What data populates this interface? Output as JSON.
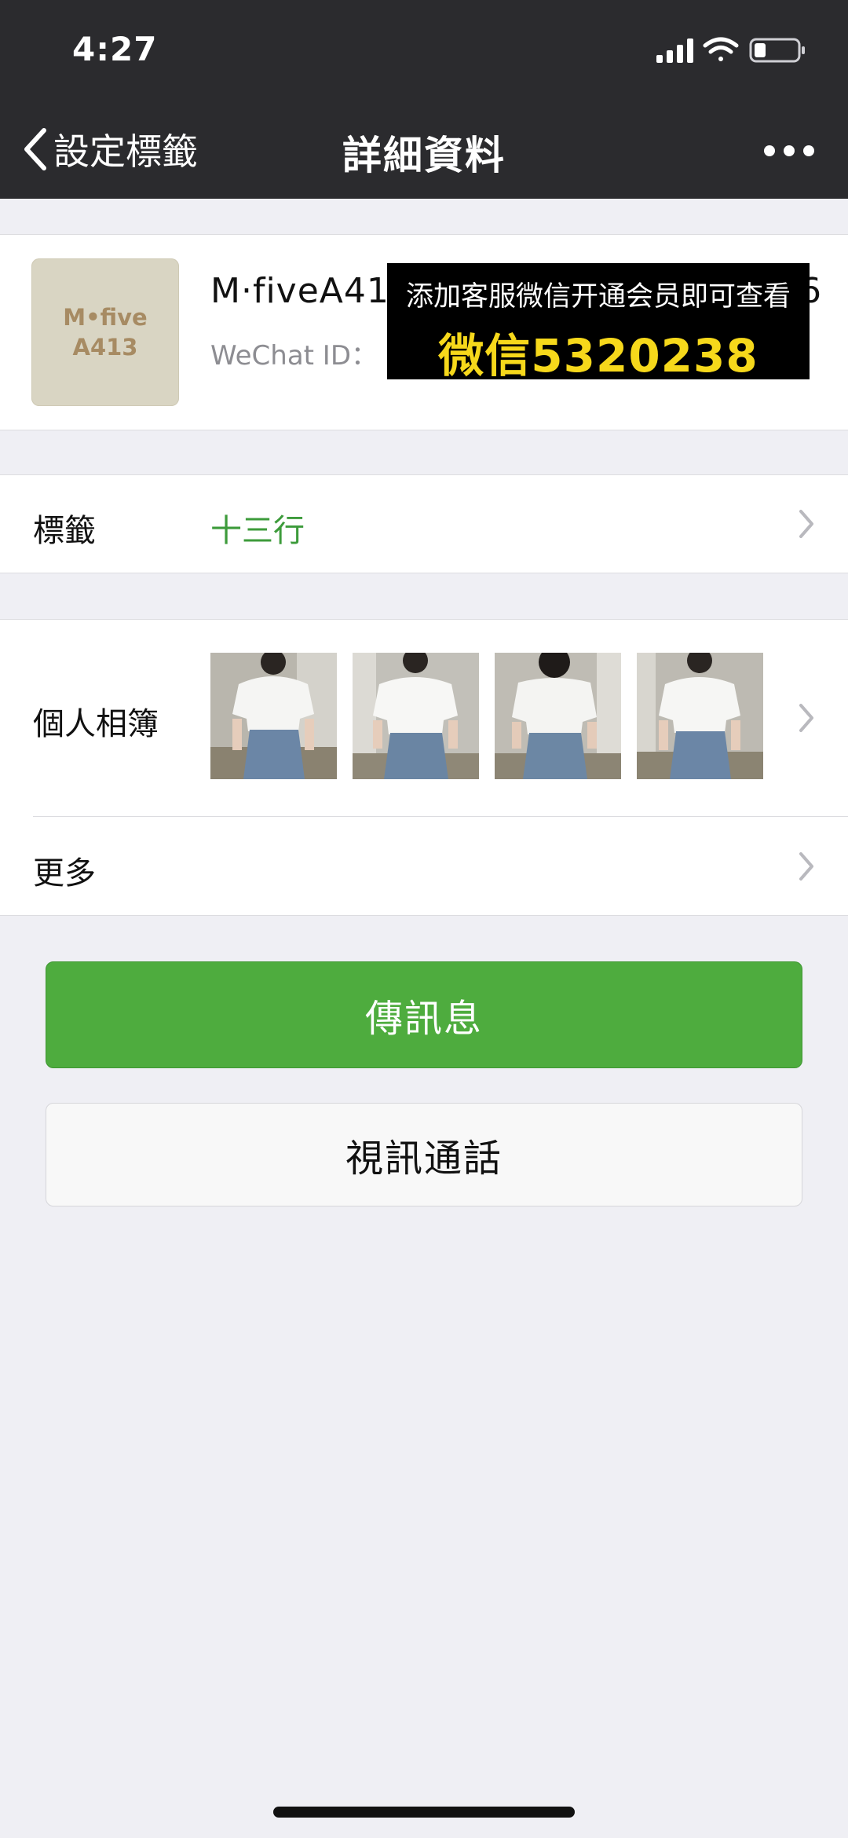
{
  "status_bar": {
    "time": "4:27"
  },
  "nav": {
    "back_label": "設定標籤",
    "title": "詳細資料"
  },
  "profile": {
    "avatar_line1": "M•five",
    "avatar_line2": "A413",
    "name": "M·fiveA41",
    "name_tail": "6",
    "wechat_id_label": "WeChat ID：",
    "promo_line1": "添加客服微信开通会员即可查看",
    "promo_line2": "微信5320238"
  },
  "tag_row": {
    "label": "標籤",
    "value": "十三行"
  },
  "album_row": {
    "label": "個人相簿",
    "photo_count": 4
  },
  "more_row": {
    "label": "更多"
  },
  "buttons": {
    "message": "傳訊息",
    "video_call": "視訊通話"
  },
  "colors": {
    "accent_green": "#4eac3e",
    "tag_green": "#3d9b3b",
    "promo_yellow": "#f6d81b",
    "nav_bg": "#2b2b2e"
  }
}
